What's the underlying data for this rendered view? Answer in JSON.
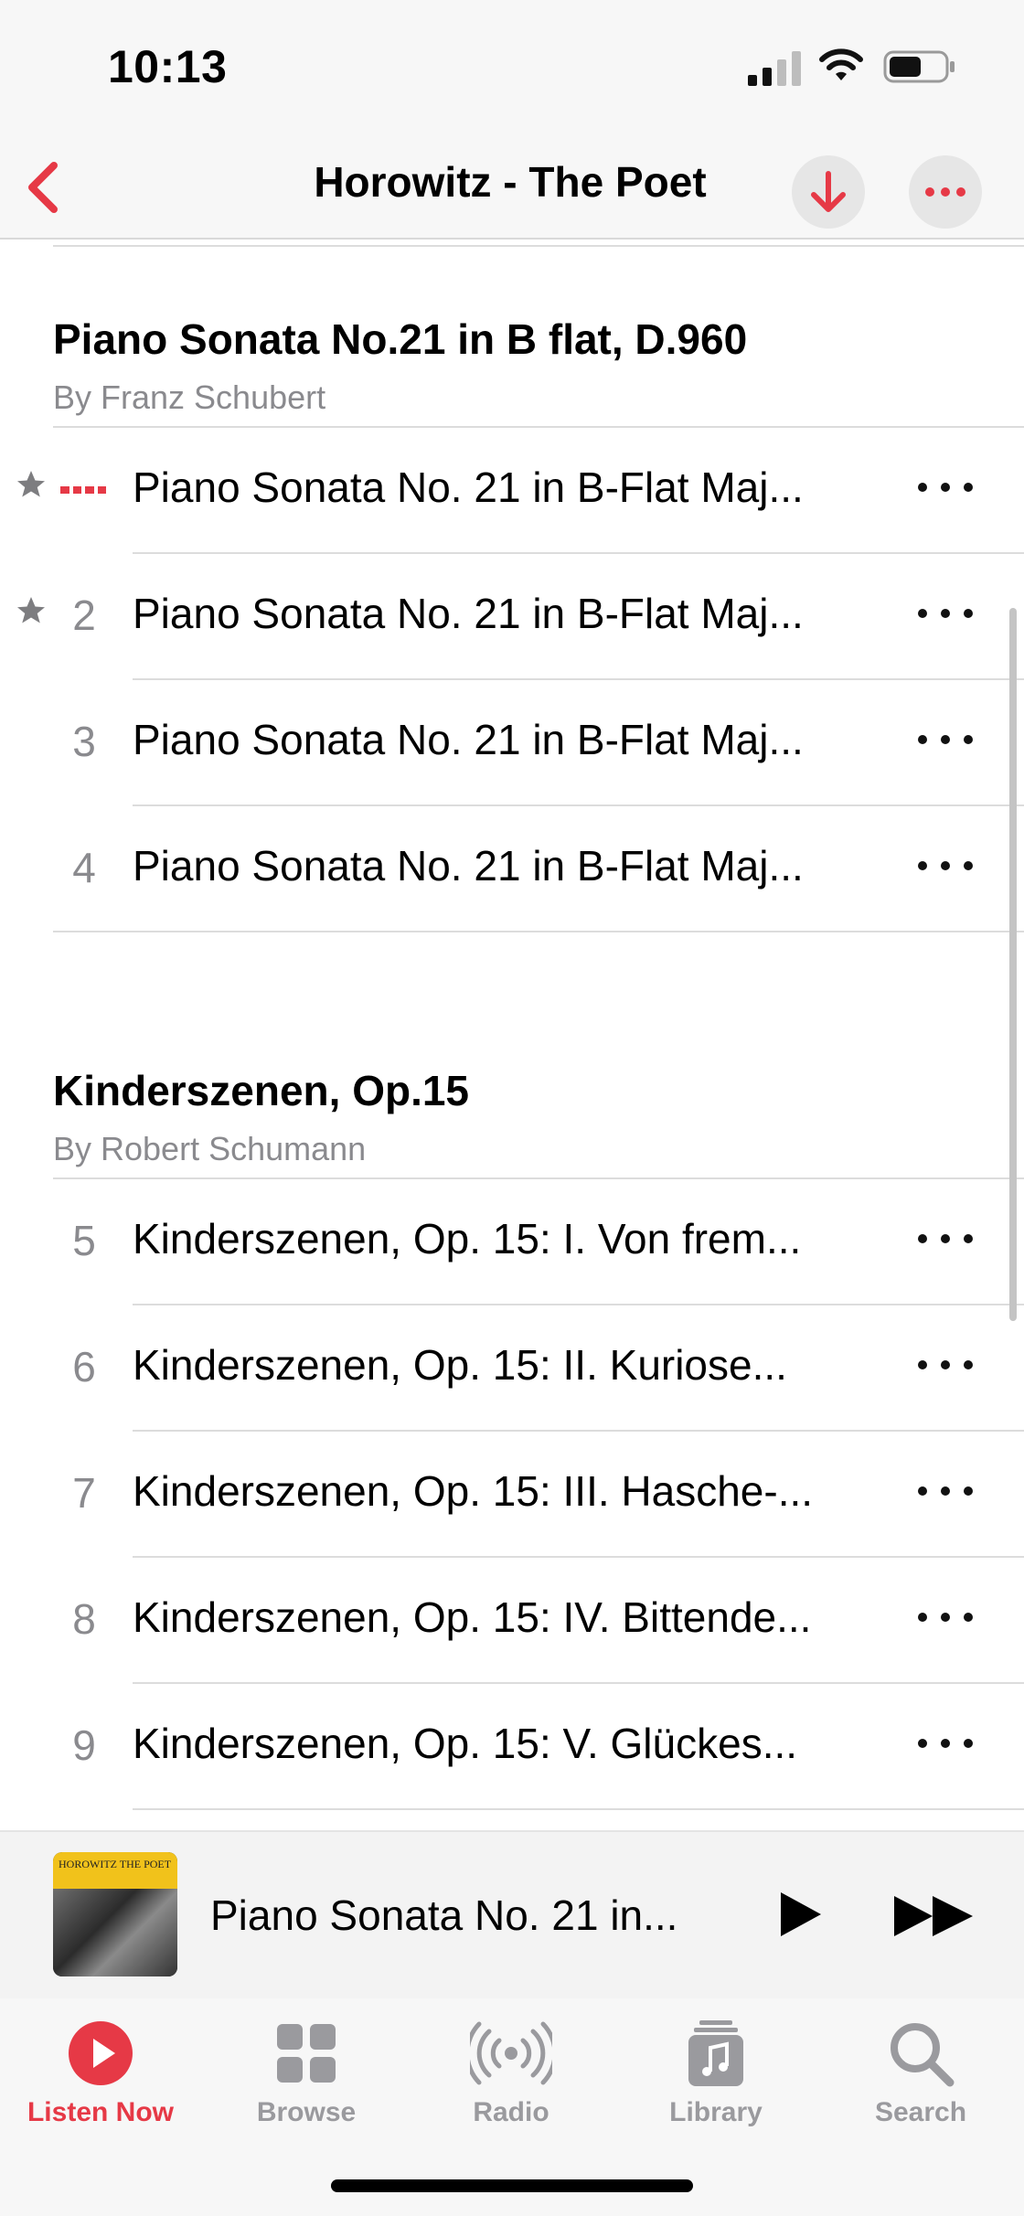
{
  "status_bar": {
    "time": "10:13"
  },
  "nav": {
    "title": "Horowitz - The Poet"
  },
  "sections": [
    {
      "title": "Piano Sonata No.21 in B flat, D.960",
      "subtitle": "By Franz Schubert",
      "tracks": [
        {
          "number": "",
          "now_playing": true,
          "starred": true,
          "title": "Piano Sonata No. 21 in B-Flat Maj..."
        },
        {
          "number": "2",
          "now_playing": false,
          "starred": true,
          "title": "Piano Sonata No. 21 in B-Flat Maj..."
        },
        {
          "number": "3",
          "now_playing": false,
          "starred": false,
          "title": "Piano Sonata No. 21 in B-Flat Maj..."
        },
        {
          "number": "4",
          "now_playing": false,
          "starred": false,
          "title": "Piano Sonata No. 21 in B-Flat Maj..."
        }
      ]
    },
    {
      "title": "Kinderszenen, Op.15",
      "subtitle": "By Robert Schumann",
      "tracks": [
        {
          "number": "5",
          "title": "Kinderszenen, Op. 15: I. Von frem..."
        },
        {
          "number": "6",
          "title": "Kinderszenen, Op. 15: II. Kuriose..."
        },
        {
          "number": "7",
          "title": "Kinderszenen, Op. 15: III. Hasche-..."
        },
        {
          "number": "8",
          "title": "Kinderszenen, Op. 15: IV. Bittende..."
        },
        {
          "number": "9",
          "title": "Kinderszenen, Op. 15: V. Glückes..."
        }
      ]
    }
  ],
  "mini_player": {
    "title": "Piano Sonata No. 21 in...",
    "artwork_text": "HOROWITZ THE POET"
  },
  "tabs": [
    {
      "label": "Listen Now",
      "icon": "play-circle-icon",
      "active": true
    },
    {
      "label": "Browse",
      "icon": "grid-icon",
      "active": false
    },
    {
      "label": "Radio",
      "icon": "radio-waves-icon",
      "active": false
    },
    {
      "label": "Library",
      "icon": "music-note-stack-icon",
      "active": false
    },
    {
      "label": "Search",
      "icon": "magnifier-icon",
      "active": false
    }
  ],
  "colors": {
    "accent": "#e63946",
    "secondary_text": "#8a8a8e",
    "inactive_tab": "#9a9a9e"
  }
}
